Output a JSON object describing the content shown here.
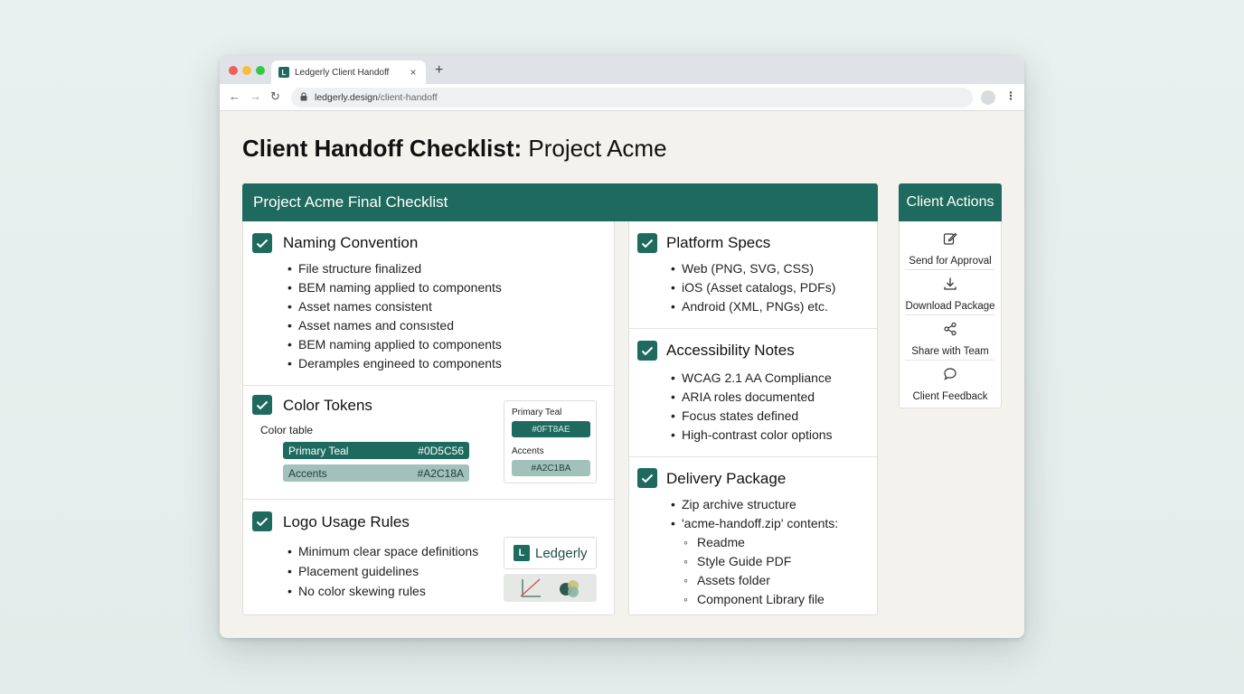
{
  "browser": {
    "tab_title": "Ledgerly Client Handoff",
    "url_domain": "ledgerly.design",
    "url_path": "/client-handoff"
  },
  "page": {
    "title_bold": "Client Handoff Checklist:",
    "title_rest": " Project Acme"
  },
  "checklist": {
    "header": "Project Acme Final Checklist",
    "naming": {
      "title": "Naming Convention",
      "items": [
        "File structure finalized",
        "BEM naming applied to components",
        "Asset names consistent",
        "Asset names and consısted",
        "BEM naming  applied to components",
        "Deramples engineed to components"
      ]
    },
    "color_tokens": {
      "title": "Color Tokens",
      "table_label": "Color table",
      "rows": [
        {
          "name": "Primary Teal",
          "hex": "#0D5C56"
        },
        {
          "name": "Accents",
          "hex": "#A2C18A"
        }
      ],
      "swatches": [
        {
          "name": "Primary Teal",
          "hex": "#0FT8AE"
        },
        {
          "name": "Accents",
          "hex": "#A2C1BA"
        }
      ]
    },
    "logo": {
      "title": "Logo Usage Rules",
      "items": [
        "Minimum clear space definitions",
        "Placement guidelines",
        "No color skewing rules"
      ],
      "logo_mark": "L",
      "logo_text": "Ledgerly"
    },
    "platform": {
      "title": "Platform Specs",
      "items": [
        "Web (PNG, SVG, CSS)",
        "iOS (Asset catalogs, PDFs)",
        "Android (XML, PNGs) etc."
      ]
    },
    "accessibility": {
      "title": "Accessibility Notes",
      "items": [
        "WCAG 2.1 AA Compliance",
        "ARIA roles documented",
        "Focus states defined",
        "High-contrast color options"
      ]
    },
    "delivery": {
      "title": "Delivery Package",
      "items": [
        "Zip archive structure",
        "'acme-handoff.zip' contents:"
      ],
      "sub_items": [
        "Readme",
        "Style Guide PDF",
        "Assets folder",
        "Component Library file"
      ]
    }
  },
  "actions": {
    "header": "Client Actions",
    "items": [
      {
        "label": "Send for Approval",
        "icon": "edit-icon"
      },
      {
        "label": "Download Package",
        "icon": "download-icon"
      },
      {
        "label": "Share with Team",
        "icon": "share-icon"
      },
      {
        "label": "Client Feedback",
        "icon": "chat-icon"
      }
    ]
  },
  "colors": {
    "brand_teal": "#1F6A5E",
    "accent": "#A2C1BA"
  }
}
